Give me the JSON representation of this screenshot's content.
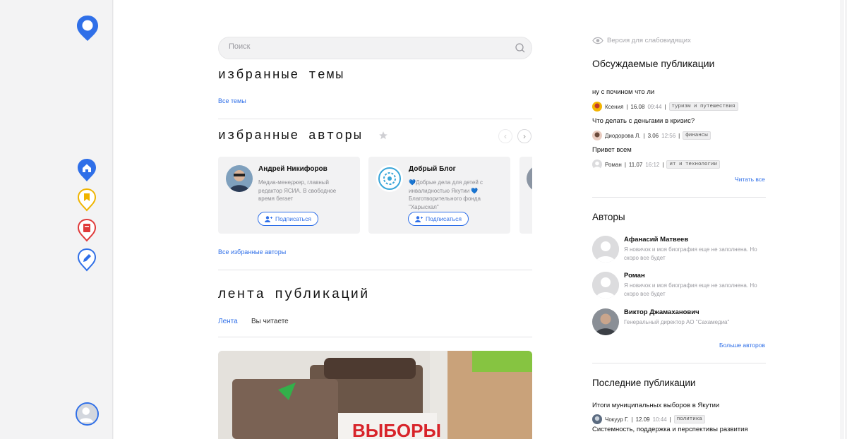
{
  "colors": {
    "accent": "#2f6fe8",
    "home": "#2f6fe8",
    "bookmark": "#f0b400",
    "book": "#e03a3a",
    "pencil": "#2f6fe8"
  },
  "rail": {
    "icons": [
      "home-icon",
      "bookmark-icon",
      "book-icon",
      "pencil-icon"
    ]
  },
  "search": {
    "placeholder": "Поиск"
  },
  "topics": {
    "title": "избранные темы",
    "all_link": "Все темы"
  },
  "authors": {
    "title": "избранные авторы",
    "all_link": "Все избранные авторы",
    "cards": [
      {
        "name": "Андрей Никифоров",
        "bio": "Медиа-менеджер, главный редактор ЯСИА. В свободное время бегает",
        "button": "Подписаться"
      },
      {
        "name": "Добрый Блог",
        "bio": "💙Добрые дела для детей с инвалидностью Якутии 💙 Благотворительного фонда \"Харысхал\"",
        "button": "Подписаться"
      }
    ]
  },
  "feed": {
    "title": "лента публикаций",
    "tabs": [
      {
        "label": "Лента"
      },
      {
        "label": "Вы читаете"
      }
    ],
    "photo_text": "ВЫБОРЫ"
  },
  "right": {
    "accessibility": "Версия для слабовидящих",
    "discussed": {
      "title": "Обсуждаемые публикации",
      "posts": [
        {
          "title": "ну с почином что ли",
          "author": "Ксения",
          "date": "16.08",
          "time": "09:44",
          "tag": "туризм и путешествия"
        },
        {
          "title": "Что делать с деньгами в кризис?",
          "author": "Диодорова Л.",
          "date": "3.06",
          "time": "12:56",
          "tag": "финансы"
        },
        {
          "title": "Привет всем",
          "author": "Роман",
          "date": "11.07",
          "time": "16:12",
          "tag": "ит и технологии"
        }
      ],
      "read_all": "Читать все"
    },
    "authors": {
      "title": "Авторы",
      "items": [
        {
          "name": "Афанасий Матвеев",
          "bio": "Я новичок и моя биография еще не заполнена. Но скоро все будет"
        },
        {
          "name": "Роман",
          "bio": "Я новичок и моя биография еще не заполнена. Но скоро все будет"
        },
        {
          "name": "Виктор Джамаханович",
          "bio": "Генеральный директор АО \"Сахамедиа\""
        }
      ],
      "more": "Больше авторов"
    },
    "latest": {
      "title": "Последние публикации",
      "posts": [
        {
          "title": "Итоги муниципальных выборов в Якутии",
          "author": "Чокуур Г.",
          "date": "12.09",
          "time": "10:44",
          "tag": "политика"
        },
        {
          "title": "Системность, поддержка и перспективы развития"
        }
      ]
    }
  }
}
